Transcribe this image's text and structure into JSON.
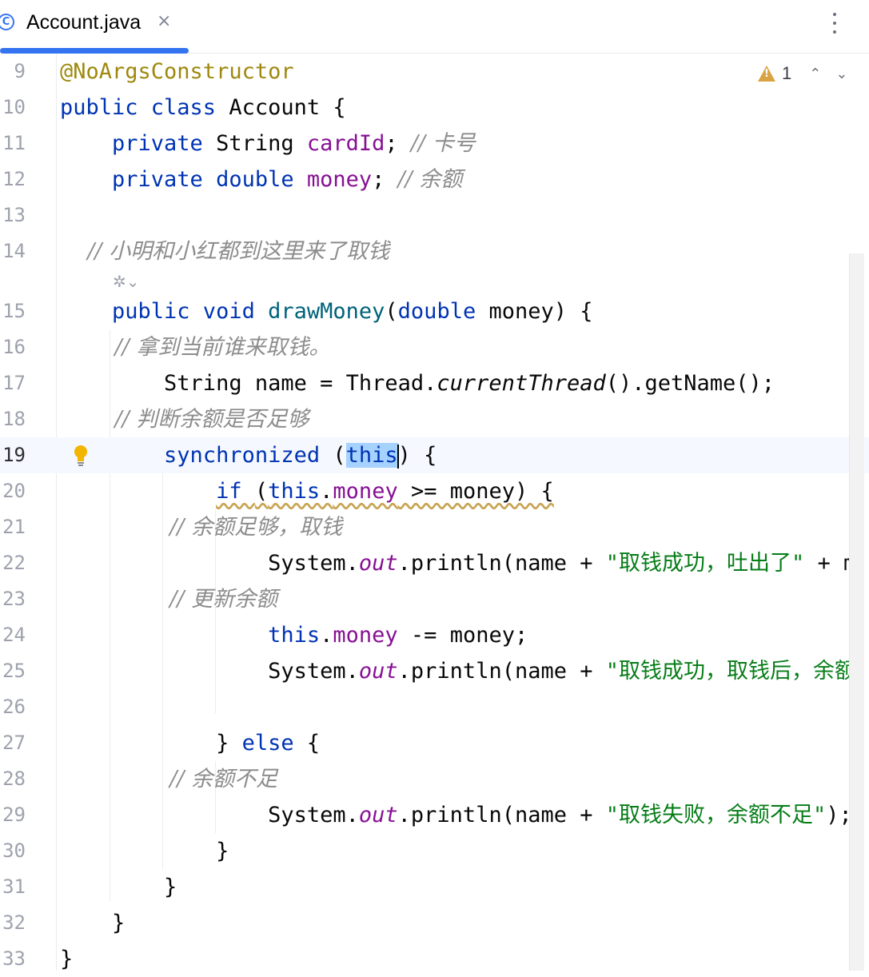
{
  "tab": {
    "label": "Account.java",
    "icon": "C",
    "close": "×"
  },
  "inspection": {
    "count": "1"
  },
  "lines": [
    {
      "n": "9"
    },
    {
      "n": "10"
    },
    {
      "n": "11"
    },
    {
      "n": "12"
    },
    {
      "n": "13"
    },
    {
      "n": "14"
    },
    {
      "n": "15"
    },
    {
      "n": "16"
    },
    {
      "n": "17"
    },
    {
      "n": "18"
    },
    {
      "n": "19"
    },
    {
      "n": "20"
    },
    {
      "n": "21"
    },
    {
      "n": "22"
    },
    {
      "n": "23"
    },
    {
      "n": "24"
    },
    {
      "n": "25"
    },
    {
      "n": "26"
    },
    {
      "n": "27"
    },
    {
      "n": "28"
    },
    {
      "n": "29"
    },
    {
      "n": "30"
    },
    {
      "n": "31"
    },
    {
      "n": "32"
    },
    {
      "n": "33"
    }
  ],
  "code": {
    "l9": "@NoArgsConstructor",
    "l10a": "public class ",
    "l10b": "Account {",
    "l11a": "    private ",
    "l11b": "String ",
    "l11c": "cardId",
    "l11d": "; ",
    "l11e": "// 卡号",
    "l12a": "    private double ",
    "l12b": "money",
    "l12c": "; ",
    "l12d": "// 余额",
    "l14": "    // 小明和小红都到这里来了取钱",
    "l15a": "    public void ",
    "l15b": "drawMoney",
    "l15c": "(",
    "l15d": "double ",
    "l15e": "money) {",
    "l16": "        // 拿到当前谁来取钱。",
    "l17a": "        String name = Thread.",
    "l17b": "currentThread",
    "l17c": "().getName();",
    "l18": "        // 判断余额是否足够",
    "l19a": "        ",
    "l19b": "synchronized ",
    "l19c": "(",
    "l19d": "this",
    "l19e": ") {",
    "l20a": "            ",
    "l20b": "if ",
    "l20c": "(",
    "l20d": "this",
    "l20e": ".",
    "l20f": "money",
    "l20g": " >= money) {",
    "l21": "                // 余额足够，取钱",
    "l22a": "                System.",
    "l22b": "out",
    "l22c": ".println(name + ",
    "l22d": "\"取钱成功，吐出了\"",
    "l22e": " + m",
    "l23": "                // 更新余额",
    "l24a": "                ",
    "l24b": "this",
    "l24c": ".",
    "l24d": "money",
    "l24e": " -= money;",
    "l25a": "                System.",
    "l25b": "out",
    "l25c": ".println(name + ",
    "l25d": "\"取钱成功，取钱后，余额",
    "l27a": "            } ",
    "l27b": "else",
    "l27c": " {",
    "l28": "                // 余额不足",
    "l29a": "                System.",
    "l29b": "out",
    "l29c": ".println(name + ",
    "l29d": "\"取钱失败，余额不足\"",
    "l29e": ");",
    "l30": "            }",
    "l31": "        }",
    "l32": "    }",
    "l33": "}"
  }
}
